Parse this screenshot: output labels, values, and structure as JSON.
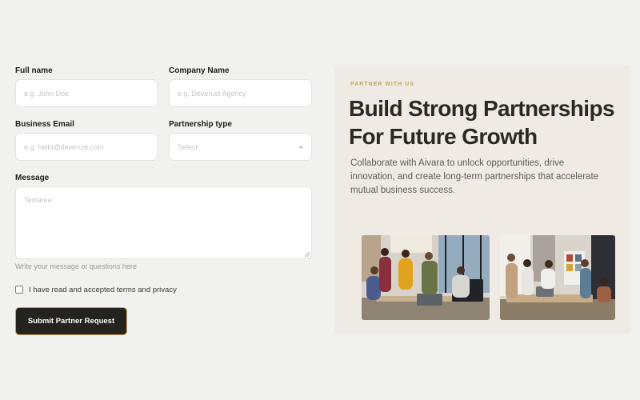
{
  "form": {
    "full_name": {
      "label": "Full name",
      "placeholder": "e.g. John Doe"
    },
    "company_name": {
      "label": "Company Name",
      "placeholder": "e.g. Deverust Agency"
    },
    "business_email": {
      "label": "Business Email",
      "placeholder": "e.g. hello@deverust.com"
    },
    "partnership_type": {
      "label": "Partnership type",
      "selected": "Select"
    },
    "message": {
      "label": "Message",
      "placeholder": "Textarea",
      "helper": "Write your message or questions here"
    },
    "terms": {
      "label": "I have read and accepted terms and privacy",
      "checked": false
    },
    "submit_label": "Submit Partner Request"
  },
  "hero": {
    "eyebrow": "PARTNER WITH US",
    "headline": "Build Strong Partnerships For Future Growth",
    "description": "Collaborate with Aivara to unlock opportunities, drive innovation, and create long-term partnerships that accelerate mutual business success."
  },
  "colors": {
    "page_background": "#f1f1f0",
    "panel_background": "#efebe4",
    "accent_gold": "#c7a55a",
    "button_dark": "#25231f"
  },
  "icons": {
    "select_chevron": "chevron-down-icon",
    "textarea_resize": "resize-grip-icon"
  }
}
